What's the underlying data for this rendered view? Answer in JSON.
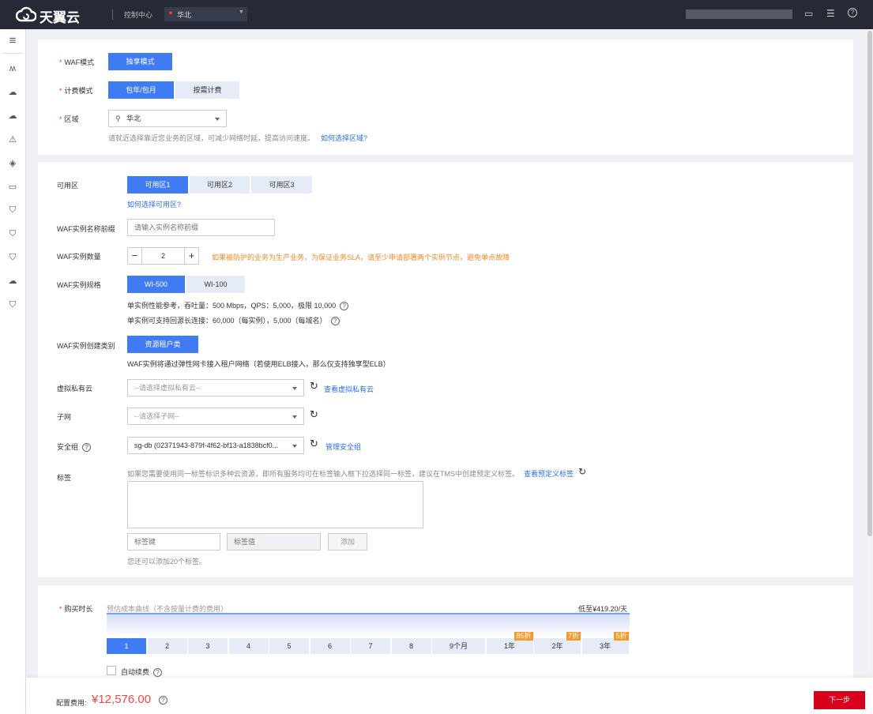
{
  "topbar": {
    "brand": "天翼云",
    "console": "控制中心",
    "region": "华北"
  },
  "card1": {
    "waf_mode_label": "WAF模式",
    "waf_mode_option": "独享模式",
    "billing_label": "计费模式",
    "billing_options": [
      "包年/包月",
      "按需计费"
    ],
    "region_label": "区域",
    "region_value": "华北",
    "region_hint": "请就近选择靠近您业务的区域，可减少网络时延，提高访问速度。",
    "region_link": "如何选择区域?"
  },
  "card2": {
    "az_label": "可用区",
    "az_options": [
      "可用区1",
      "可用区2",
      "可用区3"
    ],
    "az_link": "如何选择可用区?",
    "prefix_label": "WAF实例名称前缀",
    "prefix_placeholder": "请输入实例名称前缀",
    "count_label": "WAF实例数量",
    "count_value": "2",
    "count_warning": "如果被防护的业务为生产业务，为保证业务SLA，请至少申请部署两个实例节点，避免单点故障",
    "spec_label": "WAF实例规格",
    "spec_options": [
      "WI-500",
      "WI-100"
    ],
    "spec_perf": "单实例性能参考，吞吐量：500 Mbps，QPS：5,000，极限 10,000",
    "spec_conn": "单实例可支持回源长连接：60,000（每实例），5,000（每域名）",
    "type_label": "WAF实例创建类别",
    "type_option": "资源租户类",
    "type_hint": "WAF实例将通过弹性网卡接入租户网络（若使用ELB接入，那么仅支持独享型ELB）",
    "vpc_label": "虚拟私有云",
    "vpc_placeholder": "--请选择虚拟私有云--",
    "vpc_link": "查看虚拟私有云",
    "subnet_label": "子网",
    "subnet_placeholder": "--请选择子网--",
    "sg_label": "安全组",
    "sg_value": "sg-db (02371943-879f-4f62-bf13-a1838bcf0...",
    "sg_link": "管理安全组",
    "tag_label": "标签",
    "tag_hint": "如果您需要使用同一标签标识多种云资源，即所有服务均可在标签输入框下拉选择同一标签，建议在TMS中创建预定义标签。",
    "tag_link": "查看预定义标签",
    "tag_key_placeholder": "标签键",
    "tag_value_placeholder": "标签值",
    "tag_add": "添加",
    "tag_remaining": "您还可以添加20个标签。"
  },
  "card3": {
    "duration_label": "购买时长",
    "curve_label": "预估成本曲线（不含按量计费的费用）",
    "lowest": "低至¥419.20/天",
    "durations": [
      {
        "label": "1"
      },
      {
        "label": "2"
      },
      {
        "label": "3"
      },
      {
        "label": "4"
      },
      {
        "label": "5"
      },
      {
        "label": "6"
      },
      {
        "label": "7"
      },
      {
        "label": "8"
      },
      {
        "label": "9个月"
      },
      {
        "label": "1年",
        "discount": "85折"
      },
      {
        "label": "2年",
        "discount": "7折"
      },
      {
        "label": "3年",
        "discount": "5折"
      }
    ],
    "auto_renew": "自动续费"
  },
  "footer": {
    "fee_label": "配置费用:",
    "fee_value": "¥12,576.00",
    "next": "下一步"
  }
}
